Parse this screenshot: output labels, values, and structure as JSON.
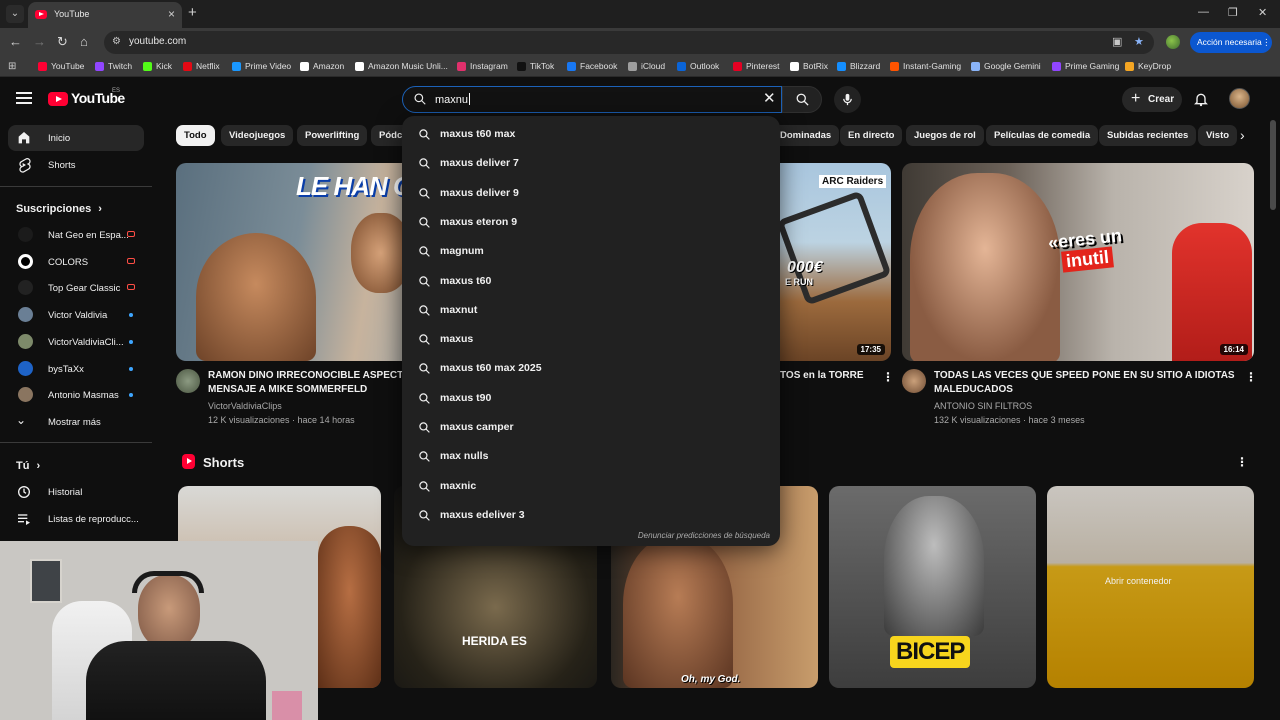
{
  "browser": {
    "tab_title": "YouTube",
    "url": "youtube.com",
    "action_button": "Acción necesaria",
    "bookmarks": [
      {
        "label": "YouTube",
        "color": "#ff0033"
      },
      {
        "label": "Twitch",
        "color": "#9146ff"
      },
      {
        "label": "Kick",
        "color": "#53fc18"
      },
      {
        "label": "Netflix",
        "color": "#e50914"
      },
      {
        "label": "Prime Video",
        "color": "#1a98ff"
      },
      {
        "label": "Amazon",
        "color": "#ffffff"
      },
      {
        "label": "Amazon Music Unli...",
        "color": "#ffffff"
      },
      {
        "label": "Instagram",
        "color": "#e1306c"
      },
      {
        "label": "TikTok",
        "color": "#111111"
      },
      {
        "label": "Facebook",
        "color": "#1877f2"
      },
      {
        "label": "iCloud",
        "color": "#9e9e9e"
      },
      {
        "label": "Outlook",
        "color": "#0a64d8"
      },
      {
        "label": "Pinterest",
        "color": "#e60023"
      },
      {
        "label": "BotRix",
        "color": "#ffffff"
      },
      {
        "label": "Blizzard",
        "color": "#148eff"
      },
      {
        "label": "Instant-Gaming",
        "color": "#ff5400"
      },
      {
        "label": "Google Gemini",
        "color": "#8ab4f8"
      },
      {
        "label": "Prime Gaming",
        "color": "#9146ff"
      },
      {
        "label": "KeyDrop",
        "color": "#f5a623"
      }
    ]
  },
  "header": {
    "logo_text": "YouTube",
    "country": "ES",
    "search_value": "maxnu",
    "create_label": "Crear"
  },
  "sidebar": {
    "main": [
      {
        "label": "Inicio",
        "icon": "home-icon"
      },
      {
        "label": "Shorts",
        "icon": "shorts-icon"
      }
    ],
    "subscriptions_title": "Suscripciones",
    "subscriptions": [
      {
        "label": "Nat Geo en Espa...",
        "badge": "live",
        "avatar_color": "#1b1b1b"
      },
      {
        "label": "COLORS",
        "badge": "live",
        "avatar_color": "#ffffff"
      },
      {
        "label": "Top Gear Classic",
        "badge": "live",
        "avatar_color": "#222222"
      },
      {
        "label": "Victor Valdivia",
        "badge": "new",
        "avatar_color": "#6a7f95"
      },
      {
        "label": "VictorValdiviaCli...",
        "badge": "new",
        "avatar_color": "#7d8a6a"
      },
      {
        "label": "bysTaXx",
        "badge": "new",
        "avatar_color": "#1e63c7"
      },
      {
        "label": "Antonio Masmas",
        "badge": "new",
        "avatar_color": "#8a7560"
      }
    ],
    "show_more": "Mostrar más",
    "you_title": "Tú",
    "you_items": [
      {
        "label": "Historial",
        "icon": "history-icon"
      },
      {
        "label": "Listas de reproducc...",
        "icon": "playlists-icon"
      }
    ]
  },
  "chips": [
    "Todo",
    "Videojuegos",
    "Powerlifting",
    "Pódca",
    "Dominadas",
    "En directo",
    "Juegos de rol",
    "Películas de comedia",
    "Subidas recientes",
    "Visto"
  ],
  "videos": [
    {
      "title_line1": "RAMON DINO IRRECONOCIBLE ASPECTO",
      "title_line2": "MENSAJE A MIKE SOMMERFELD",
      "channel": "VictorValdiviaClips",
      "meta": "12 K visualizaciones · hace 14 horas",
      "thumb_text": "LE HAN C"
    },
    {
      "title_line1": "TOS en la TORRE",
      "duration": "17:35",
      "thumb_text": "ARC Raiders",
      "thumb_text2": "000€",
      "thumb_text3": "E RUN"
    },
    {
      "title_line1": "TODAS LAS VECES QUE SPEED PONE EN SU SITIO A IDIOTAS",
      "title_line2": "MALEDUCADOS",
      "channel": "ANTONIO SIN FILTROS",
      "meta": "132 K visualizaciones · hace 3 meses",
      "duration": "16:14",
      "thumb_text": "«eres un",
      "thumb_text2": "inutil"
    }
  ],
  "shorts": {
    "title": "Shorts",
    "captions": [
      "HERIDA ES",
      "Oh, my God.",
      "BICEP",
      "Abrir contenedor"
    ]
  },
  "suggestions": [
    "maxus t60 max",
    "maxus deliver 7",
    "maxus deliver 9",
    "maxus eteron 9",
    "magnum",
    "maxus t60",
    "maxnut",
    "maxus",
    "maxus t60 max 2025",
    "maxus t90",
    "maxus camper",
    "max nulls",
    "maxnic",
    "maxus edeliver 3"
  ],
  "report_link": "Denunciar predicciones de búsqueda"
}
